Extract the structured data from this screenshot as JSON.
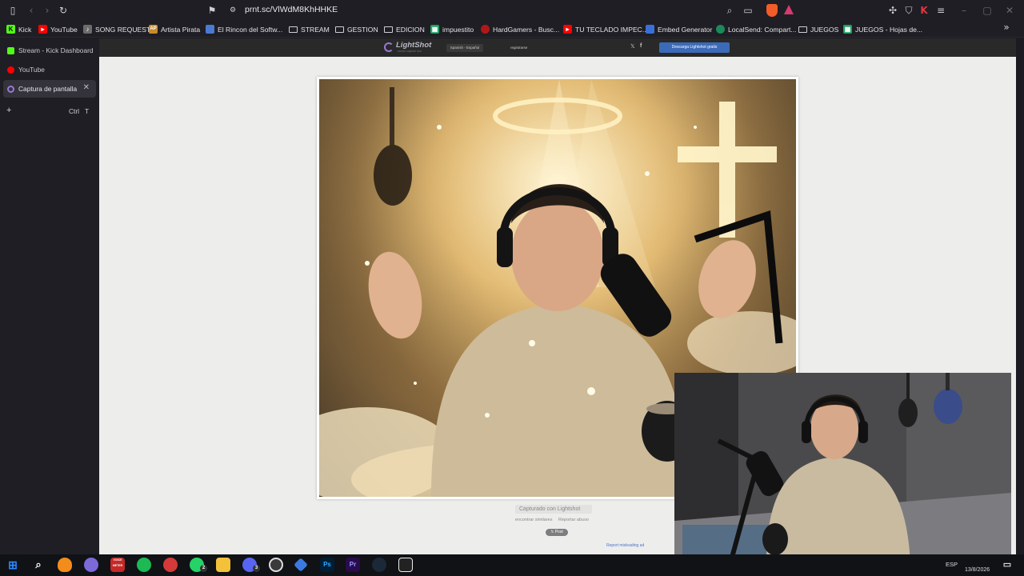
{
  "browser": {
    "url": "prnt.sc/VlWdM8KhHHKE"
  },
  "bookmarks": [
    {
      "label": "Kick",
      "icon": "kick-icon",
      "color": "#53fc18"
    },
    {
      "label": "YouTube",
      "icon": "youtube-icon",
      "color": "#ff0000"
    },
    {
      "label": "SONG REQUEST",
      "icon": "song-request-icon",
      "color": "#6c6c6c"
    },
    {
      "label": "Artista Pirata",
      "icon": "artista-pirata-icon",
      "color": "#c88b2a"
    },
    {
      "label": "El Rincon del Softw...",
      "icon": "page-icon",
      "color": "#4a7bd0"
    },
    {
      "label": "STREAM",
      "icon": "folder-icon",
      "color": ""
    },
    {
      "label": "GESTION",
      "icon": "folder-icon",
      "color": ""
    },
    {
      "label": "EDICION",
      "icon": "folder-icon",
      "color": ""
    },
    {
      "label": "impuestito",
      "icon": "sheets-icon",
      "color": "#1ea362"
    },
    {
      "label": "HardGamers - Busc...",
      "icon": "hardgamers-icon",
      "color": "#b01818"
    },
    {
      "label": "TU TECLADO IMPEC...",
      "icon": "youtube-icon",
      "color": "#ff0000"
    },
    {
      "label": "Embed Generator",
      "icon": "embed-icon",
      "color": "#3a6fd8"
    },
    {
      "label": "LocalSend: Compart...",
      "icon": "localsend-icon",
      "color": "#1a8a5a"
    },
    {
      "label": "JUEGOS",
      "icon": "folder-icon",
      "color": ""
    },
    {
      "label": "JUEGOS - Hojas de...",
      "icon": "sheets-icon",
      "color": "#1ea362"
    }
  ],
  "sidebar": {
    "tabs": [
      {
        "label": "Stream - Kick Dashboard",
        "icon": "kick-icon",
        "color": "#53fc18",
        "active": false
      },
      {
        "label": "YouTube",
        "icon": "youtube-icon",
        "color": "#ff0000",
        "active": false
      },
      {
        "label": "Captura de pantalla",
        "icon": "lightshot-icon",
        "color": "#9a78d8",
        "active": true
      }
    ],
    "new_tab_plus": "+",
    "new_tab_shortcut_ctrl": "Ctrl",
    "new_tab_shortcut_key": "T",
    "close_glyph": "✕"
  },
  "lightshot": {
    "logo_name": "LightShot",
    "logo_tagline": "screen capture tool",
    "language": "Spanish - Español",
    "register": "registrarse",
    "twitter": "𝕏",
    "facebook": "f",
    "download": "Descarga Lightshot gratis",
    "caption": "Capturado con Lightshot",
    "find_similar": "encontrar similares",
    "report_abuse": "Reportar abuso",
    "post": "𝕏 Post",
    "report_ad": "Report misleading ad"
  },
  "taskbar": {
    "language": "ESP",
    "date": "13/8/2026",
    "icons": [
      {
        "name": "windows-start-icon",
        "color": "#2b88ff"
      },
      {
        "name": "search-icon",
        "color": ""
      },
      {
        "name": "fl-studio-icon",
        "color": "#f28c1b"
      },
      {
        "name": "app-icon",
        "color": "#7b6ad8"
      },
      {
        "name": "voicemeeter-icon",
        "color": "#c62828"
      },
      {
        "name": "spotify-icon",
        "color": "#1db954"
      },
      {
        "name": "app-red-icon",
        "color": "#d43a3a"
      },
      {
        "name": "whatsapp-icon",
        "color": "#25d366"
      },
      {
        "name": "file-explorer-icon",
        "color": "#f3c13a"
      },
      {
        "name": "discord-icon",
        "color": "#5865f2"
      },
      {
        "name": "obs-icon",
        "color": "#3a3a3a"
      },
      {
        "name": "app-blue-icon",
        "color": "#3b7ae0"
      },
      {
        "name": "photoshop-icon",
        "color": "#001e36"
      },
      {
        "name": "premiere-icon",
        "color": "#2a0b4d"
      },
      {
        "name": "steam-icon",
        "color": "#1b2838"
      },
      {
        "name": "epic-games-icon",
        "color": "#222"
      }
    ],
    "whatsapp_badge": "2",
    "discord_badge": "3",
    "voicemeeter_label": "VOICE METER",
    "photoshop_label": "Ps",
    "premiere_label": "Pr"
  }
}
